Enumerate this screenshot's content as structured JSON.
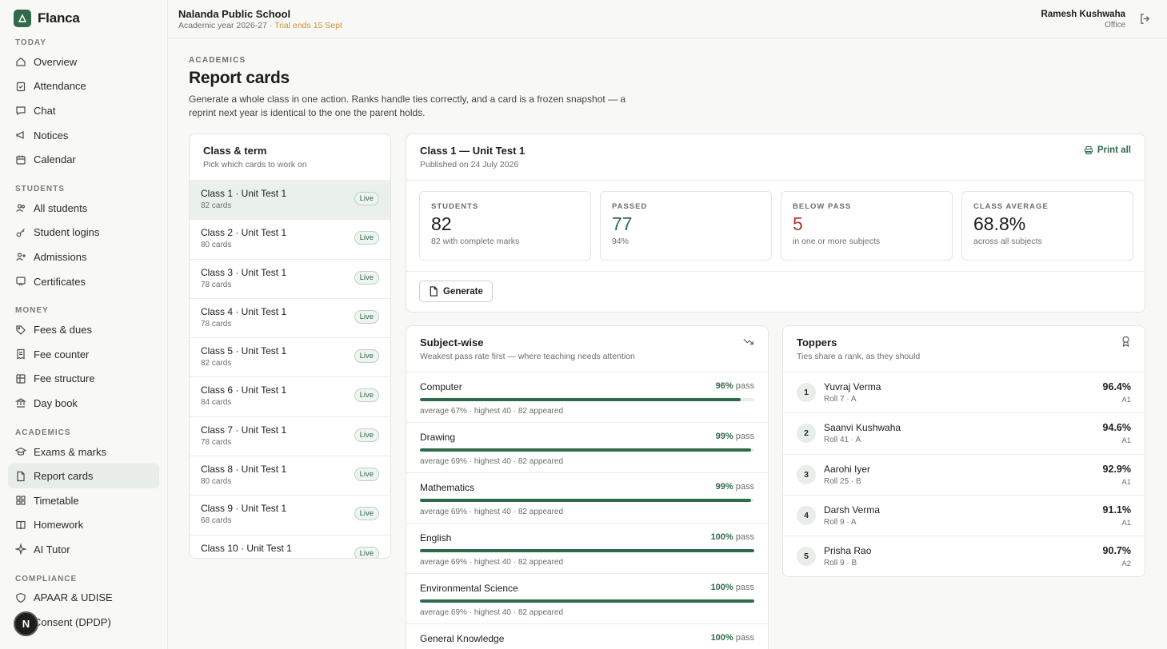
{
  "brand": {
    "name": "Flanca"
  },
  "sidebar": {
    "sections": [
      {
        "title": "TODAY",
        "items": [
          {
            "label": "Overview",
            "icon": "home-icon"
          },
          {
            "label": "Attendance",
            "icon": "clipboard-check-icon"
          },
          {
            "label": "Chat",
            "icon": "chat-icon"
          },
          {
            "label": "Notices",
            "icon": "megaphone-icon"
          },
          {
            "label": "Calendar",
            "icon": "calendar-icon"
          }
        ]
      },
      {
        "title": "STUDENTS",
        "items": [
          {
            "label": "All students",
            "icon": "users-icon"
          },
          {
            "label": "Student logins",
            "icon": "key-icon"
          },
          {
            "label": "Admissions",
            "icon": "user-plus-icon"
          },
          {
            "label": "Certificates",
            "icon": "certificate-icon"
          }
        ]
      },
      {
        "title": "MONEY",
        "items": [
          {
            "label": "Fees & dues",
            "icon": "tag-icon"
          },
          {
            "label": "Fee counter",
            "icon": "receipt-icon"
          },
          {
            "label": "Fee structure",
            "icon": "table-icon"
          },
          {
            "label": "Day book",
            "icon": "bank-icon"
          }
        ]
      },
      {
        "title": "ACADEMICS",
        "items": [
          {
            "label": "Exams & marks",
            "icon": "graduation-cap-icon"
          },
          {
            "label": "Report cards",
            "icon": "file-icon",
            "active": true
          },
          {
            "label": "Timetable",
            "icon": "grid-icon"
          },
          {
            "label": "Homework",
            "icon": "book-icon"
          },
          {
            "label": "AI Tutor",
            "icon": "sparkle-icon"
          }
        ]
      },
      {
        "title": "COMPLIANCE",
        "items": [
          {
            "label": "APAAR & UDISE",
            "icon": "shield-icon"
          },
          {
            "label": "Consent (DPDP)",
            "icon": "shield-check-icon"
          }
        ]
      }
    ],
    "fab_label": "N"
  },
  "topbar": {
    "school": "Nalanda Public School",
    "academic_year": "Academic year 2026-27",
    "separator": " · ",
    "trial": "Trial ends 15 Sept",
    "user_name": "Ramesh Kushwaha",
    "user_role": "Office"
  },
  "page": {
    "eyebrow": "ACADEMICS",
    "title": "Report cards",
    "description": "Generate a whole class in one action. Ranks handle ties correctly, and a card is a frozen snapshot — a reprint next year is identical to the one the parent holds."
  },
  "classlist": {
    "title": "Class & term",
    "subtitle": "Pick which cards to work on",
    "items": [
      {
        "name": "Class 1 · Unit Test 1",
        "count": "82 cards",
        "status": "Live",
        "active": true
      },
      {
        "name": "Class 2 · Unit Test 1",
        "count": "80 cards",
        "status": "Live"
      },
      {
        "name": "Class 3 · Unit Test 1",
        "count": "78 cards",
        "status": "Live"
      },
      {
        "name": "Class 4 · Unit Test 1",
        "count": "78 cards",
        "status": "Live"
      },
      {
        "name": "Class 5 · Unit Test 1",
        "count": "82 cards",
        "status": "Live"
      },
      {
        "name": "Class 6 · Unit Test 1",
        "count": "84 cards",
        "status": "Live"
      },
      {
        "name": "Class 7 · Unit Test 1",
        "count": "78 cards",
        "status": "Live"
      },
      {
        "name": "Class 8 · Unit Test 1",
        "count": "80 cards",
        "status": "Live"
      },
      {
        "name": "Class 9 · Unit Test 1",
        "count": "68 cards",
        "status": "Live"
      },
      {
        "name": "Class 10 · Unit Test 1",
        "count": "",
        "status": "Live"
      }
    ]
  },
  "summary": {
    "title": "Class 1 — Unit Test 1",
    "published": "Published on 24 July 2026",
    "print_all": "Print all",
    "generate": "Generate",
    "stats": [
      {
        "label": "STUDENTS",
        "value": "82",
        "note": "82 with complete marks",
        "tone": ""
      },
      {
        "label": "PASSED",
        "value": "77",
        "note": "94%",
        "tone": "green"
      },
      {
        "label": "BELOW PASS",
        "value": "5",
        "note": "in one or more subjects",
        "tone": "red"
      },
      {
        "label": "CLASS AVERAGE",
        "value": "68.8%",
        "note": "across all subjects",
        "tone": ""
      }
    ]
  },
  "subjects": {
    "title": "Subject-wise",
    "subtitle": "Weakest pass rate first — where teaching needs attention",
    "pass_suffix": " pass",
    "items": [
      {
        "name": "Computer",
        "pass": "96%",
        "pass_rate": 96,
        "meta": "average 67% · highest 40 · 82 appeared"
      },
      {
        "name": "Drawing",
        "pass": "99%",
        "pass_rate": 99,
        "meta": "average 69% · highest 40 · 82 appeared"
      },
      {
        "name": "Mathematics",
        "pass": "99%",
        "pass_rate": 99,
        "meta": "average 69% · highest 40 · 82 appeared"
      },
      {
        "name": "English",
        "pass": "100%",
        "pass_rate": 100,
        "meta": "average 69% · highest 40 · 82 appeared"
      },
      {
        "name": "Environmental Science",
        "pass": "100%",
        "pass_rate": 100,
        "meta": "average 69% · highest 40 · 82 appeared"
      },
      {
        "name": "General Knowledge",
        "pass": "100%",
        "pass_rate": 100,
        "meta": ""
      }
    ]
  },
  "toppers": {
    "title": "Toppers",
    "subtitle": "Ties share a rank, as they should",
    "items": [
      {
        "rank": "1",
        "name": "Yuvraj Verma",
        "roll": "Roll 7 · A",
        "pct": "96.4%",
        "grade": "A1"
      },
      {
        "rank": "2",
        "name": "Saanvi Kushwaha",
        "roll": "Roll 41 · A",
        "pct": "94.6%",
        "grade": "A1"
      },
      {
        "rank": "3",
        "name": "Aarohi Iyer",
        "roll": "Roll 25 · B",
        "pct": "92.9%",
        "grade": "A1"
      },
      {
        "rank": "4",
        "name": "Darsh Verma",
        "roll": "Roll 9 · A",
        "pct": "91.1%",
        "grade": "A1"
      },
      {
        "rank": "5",
        "name": "Prisha Rao",
        "roll": "Roll 9 · B",
        "pct": "90.7%",
        "grade": "A2"
      }
    ]
  }
}
